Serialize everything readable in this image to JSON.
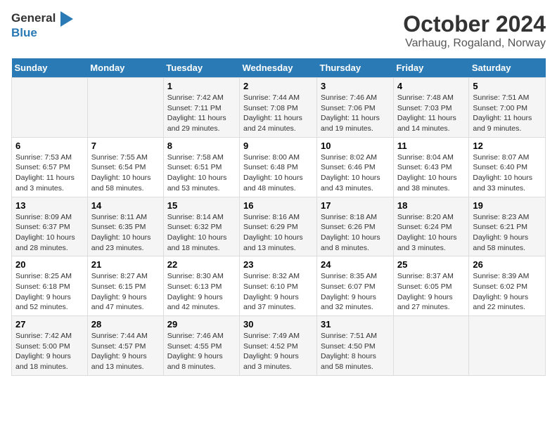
{
  "header": {
    "logo_general": "General",
    "logo_blue": "Blue",
    "title": "October 2024",
    "subtitle": "Varhaug, Rogaland, Norway"
  },
  "calendar": {
    "days_of_week": [
      "Sunday",
      "Monday",
      "Tuesday",
      "Wednesday",
      "Thursday",
      "Friday",
      "Saturday"
    ],
    "weeks": [
      [
        {
          "day": "",
          "info": ""
        },
        {
          "day": "",
          "info": ""
        },
        {
          "day": "1",
          "info": "Sunrise: 7:42 AM\nSunset: 7:11 PM\nDaylight: 11 hours and 29 minutes."
        },
        {
          "day": "2",
          "info": "Sunrise: 7:44 AM\nSunset: 7:08 PM\nDaylight: 11 hours and 24 minutes."
        },
        {
          "day": "3",
          "info": "Sunrise: 7:46 AM\nSunset: 7:06 PM\nDaylight: 11 hours and 19 minutes."
        },
        {
          "day": "4",
          "info": "Sunrise: 7:48 AM\nSunset: 7:03 PM\nDaylight: 11 hours and 14 minutes."
        },
        {
          "day": "5",
          "info": "Sunrise: 7:51 AM\nSunset: 7:00 PM\nDaylight: 11 hours and 9 minutes."
        }
      ],
      [
        {
          "day": "6",
          "info": "Sunrise: 7:53 AM\nSunset: 6:57 PM\nDaylight: 11 hours and 3 minutes."
        },
        {
          "day": "7",
          "info": "Sunrise: 7:55 AM\nSunset: 6:54 PM\nDaylight: 10 hours and 58 minutes."
        },
        {
          "day": "8",
          "info": "Sunrise: 7:58 AM\nSunset: 6:51 PM\nDaylight: 10 hours and 53 minutes."
        },
        {
          "day": "9",
          "info": "Sunrise: 8:00 AM\nSunset: 6:48 PM\nDaylight: 10 hours and 48 minutes."
        },
        {
          "day": "10",
          "info": "Sunrise: 8:02 AM\nSunset: 6:46 PM\nDaylight: 10 hours and 43 minutes."
        },
        {
          "day": "11",
          "info": "Sunrise: 8:04 AM\nSunset: 6:43 PM\nDaylight: 10 hours and 38 minutes."
        },
        {
          "day": "12",
          "info": "Sunrise: 8:07 AM\nSunset: 6:40 PM\nDaylight: 10 hours and 33 minutes."
        }
      ],
      [
        {
          "day": "13",
          "info": "Sunrise: 8:09 AM\nSunset: 6:37 PM\nDaylight: 10 hours and 28 minutes."
        },
        {
          "day": "14",
          "info": "Sunrise: 8:11 AM\nSunset: 6:35 PM\nDaylight: 10 hours and 23 minutes."
        },
        {
          "day": "15",
          "info": "Sunrise: 8:14 AM\nSunset: 6:32 PM\nDaylight: 10 hours and 18 minutes."
        },
        {
          "day": "16",
          "info": "Sunrise: 8:16 AM\nSunset: 6:29 PM\nDaylight: 10 hours and 13 minutes."
        },
        {
          "day": "17",
          "info": "Sunrise: 8:18 AM\nSunset: 6:26 PM\nDaylight: 10 hours and 8 minutes."
        },
        {
          "day": "18",
          "info": "Sunrise: 8:20 AM\nSunset: 6:24 PM\nDaylight: 10 hours and 3 minutes."
        },
        {
          "day": "19",
          "info": "Sunrise: 8:23 AM\nSunset: 6:21 PM\nDaylight: 9 hours and 58 minutes."
        }
      ],
      [
        {
          "day": "20",
          "info": "Sunrise: 8:25 AM\nSunset: 6:18 PM\nDaylight: 9 hours and 52 minutes."
        },
        {
          "day": "21",
          "info": "Sunrise: 8:27 AM\nSunset: 6:15 PM\nDaylight: 9 hours and 47 minutes."
        },
        {
          "day": "22",
          "info": "Sunrise: 8:30 AM\nSunset: 6:13 PM\nDaylight: 9 hours and 42 minutes."
        },
        {
          "day": "23",
          "info": "Sunrise: 8:32 AM\nSunset: 6:10 PM\nDaylight: 9 hours and 37 minutes."
        },
        {
          "day": "24",
          "info": "Sunrise: 8:35 AM\nSunset: 6:07 PM\nDaylight: 9 hours and 32 minutes."
        },
        {
          "day": "25",
          "info": "Sunrise: 8:37 AM\nSunset: 6:05 PM\nDaylight: 9 hours and 27 minutes."
        },
        {
          "day": "26",
          "info": "Sunrise: 8:39 AM\nSunset: 6:02 PM\nDaylight: 9 hours and 22 minutes."
        }
      ],
      [
        {
          "day": "27",
          "info": "Sunrise: 7:42 AM\nSunset: 5:00 PM\nDaylight: 9 hours and 18 minutes."
        },
        {
          "day": "28",
          "info": "Sunrise: 7:44 AM\nSunset: 4:57 PM\nDaylight: 9 hours and 13 minutes."
        },
        {
          "day": "29",
          "info": "Sunrise: 7:46 AM\nSunset: 4:55 PM\nDaylight: 9 hours and 8 minutes."
        },
        {
          "day": "30",
          "info": "Sunrise: 7:49 AM\nSunset: 4:52 PM\nDaylight: 9 hours and 3 minutes."
        },
        {
          "day": "31",
          "info": "Sunrise: 7:51 AM\nSunset: 4:50 PM\nDaylight: 8 hours and 58 minutes."
        },
        {
          "day": "",
          "info": ""
        },
        {
          "day": "",
          "info": ""
        }
      ]
    ]
  }
}
